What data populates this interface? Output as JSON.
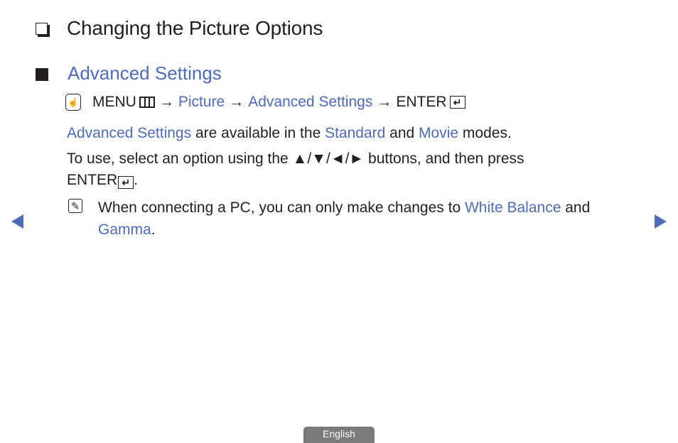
{
  "heading": {
    "title": "Changing the Picture Options",
    "icon": "hollow-square-icon"
  },
  "section": {
    "title": "Advanced Settings",
    "icon": "filled-square-icon"
  },
  "menu_path": {
    "remote_icon": "remote-hand-icon",
    "menu_label": "MENU",
    "menu_icon": "menu-icon",
    "arrow": "→",
    "items": [
      "Picture",
      "Advanced Settings"
    ],
    "enter_label": "ENTER",
    "enter_icon": "enter-icon",
    "enter_glyph": "↵"
  },
  "paragraph1": {
    "parts": [
      {
        "text": "Advanced Settings",
        "highlight": true
      },
      {
        "text": " are available in the ",
        "highlight": false
      },
      {
        "text": "Standard",
        "highlight": true
      },
      {
        "text": " and ",
        "highlight": false
      },
      {
        "text": "Movie",
        "highlight": true
      },
      {
        "text": " modes.",
        "highlight": false
      }
    ]
  },
  "paragraph2": {
    "text": "To use, select an option using the ▲/▼/◄/► buttons, and then press",
    "enter_label": "ENTER",
    "enter_glyph": "↵",
    "suffix": "."
  },
  "note": {
    "icon": "note-pencil-icon",
    "parts": [
      {
        "text": "When connecting a PC, you can only make changes to ",
        "highlight": false
      },
      {
        "text": "White Balance",
        "highlight": true
      },
      {
        "text": " and ",
        "highlight": false
      },
      {
        "text": "Gamma",
        "highlight": true
      },
      {
        "text": ".",
        "highlight": false
      }
    ]
  },
  "navigation": {
    "prev_icon": "previous-page-arrow-icon",
    "next_icon": "next-page-arrow-icon"
  },
  "language_tab": {
    "label": "English"
  },
  "colors": {
    "accent": "#4f6ab8",
    "text": "#231f20",
    "language_tab_bg": "#7a7a7a"
  }
}
